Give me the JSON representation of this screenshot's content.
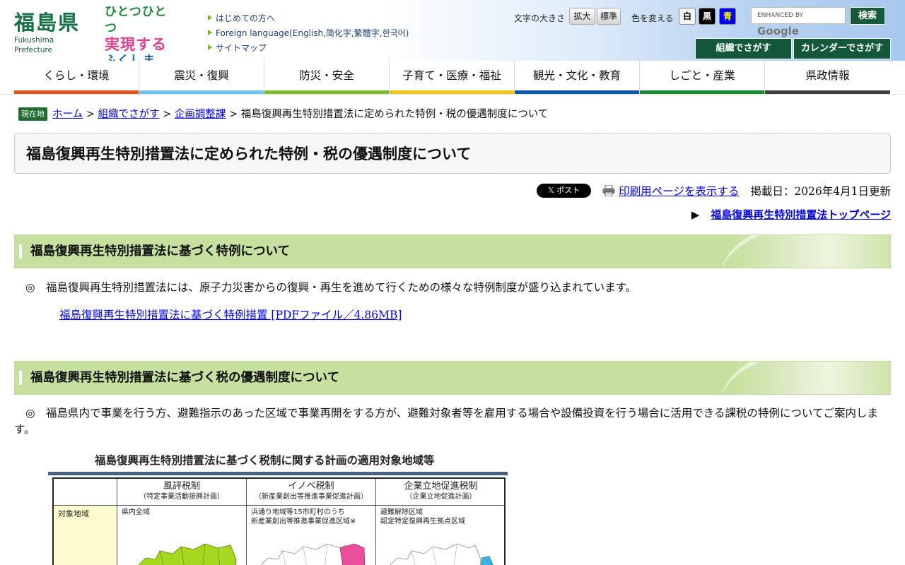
{
  "header": {
    "logo_jp": "福島県",
    "logo_en": "Fukushima Prefecture",
    "slogan": [
      "ひとつひとつ",
      "実現する",
      "ふくしま"
    ],
    "quick_links": [
      "はじめての方へ",
      "Foreign language(English,简化字,繁體字,한국어)",
      "サイトマップ"
    ],
    "font_size_label": "文字の大きさ",
    "font_size_buttons": [
      "拡大",
      "標準"
    ],
    "color_label": "色を変える",
    "color_buttons": [
      "白",
      "黒",
      "青"
    ],
    "search_placeholder": "ENHANCED BY",
    "search_brand": "Google",
    "search_button": "検索",
    "org_search_button": "組織でさがす",
    "calendar_search_button": "カレンダーでさがす"
  },
  "nav": {
    "items": [
      {
        "label": "くらし・環境",
        "color": "#e0531b"
      },
      {
        "label": "震災・復興",
        "color": "#6ec4e8"
      },
      {
        "label": "防災・安全",
        "color": "#7dbb2e"
      },
      {
        "label": "子育て・医療・福祉",
        "color": "#f2c318"
      },
      {
        "label": "観光・文化・教育",
        "color": "#0a57ad"
      },
      {
        "label": "しごと・産業",
        "color": "#158a2e"
      },
      {
        "label": "県政情報",
        "color": "#3f3f3f"
      }
    ]
  },
  "breadcrumb": {
    "here_label": "現在地",
    "items": [
      "ホーム",
      "組織でさがす",
      "企画調整課"
    ],
    "separator": ">",
    "current": "福島復興再生特別措置法に定められた特例・税の優遇制度について"
  },
  "page": {
    "title": "福島復興再生特別措置法に定められた特例・税の優遇制度について",
    "post_button": "𝕏 ポスト",
    "print_link": "印刷用ページを表示する",
    "updated": "掲載日：2026年4月1日更新",
    "top_arrow": "▶",
    "top_link": "福島復興再生特別措置法トップページ"
  },
  "section1": {
    "heading": "福島復興再生特別措置法に基づく特例について",
    "text": "◎　福島復興再生特別措置法には、原子力災害からの復興・再生を進めて行くための様々な特例制度が盛り込まれています。",
    "link": "福島復興再生特別措置法に基づく特例措置 [PDFファイル／4.86MB]"
  },
  "section2": {
    "heading": "福島復興再生特別措置法に基づく税の優遇制度について",
    "text": "◎　福島県内で事業を行う方、避難指示のあった区域で事業再開をする方が、避難対象者等を雇用する場合や設備投資を行う場合に活用できる課税の特例についてご案内します。"
  },
  "figure": {
    "title": "福島復興再生特別措置法に基づく税制に関する計画の適用対象地域等",
    "row_label": "対象地域",
    "columns": [
      {
        "name": "風評税制",
        "sub": "（特定事業活動振興計画）",
        "color": "#c5f09b",
        "body": "県内全域"
      },
      {
        "name": "イノベ税制",
        "sub": "（新産業創出等推進事業促進計画）",
        "color": "#f8c7f0",
        "body": "浜通り地域等15市町村のうち\n新産業創出等推進事業促進区域※"
      },
      {
        "name": "企業立地促進税制",
        "sub": "（企業立地促進計画）",
        "color": "#bfe5ef",
        "body": "避難解除区域\n認定特定復興再生拠点区域"
      }
    ]
  }
}
